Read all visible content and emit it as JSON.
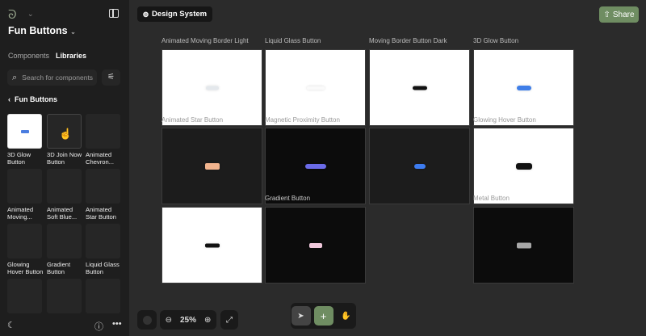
{
  "sidebar": {
    "project": "Fun Buttons",
    "tabs": [
      "Components",
      "Libraries"
    ],
    "search_placeholder": "Search for components",
    "breadcrumb": "Fun Buttons",
    "items": [
      "3D Glow Button",
      "3D Join Now Button",
      "Animated Chevron...",
      "Animated Moving...",
      "Animated Soft Blue...",
      "Animated Star Button",
      "Glowing Hover Button",
      "Gradient Button",
      "Liquid Glass Button",
      "",
      "",
      ""
    ]
  },
  "header": {
    "pill": "Design System",
    "share": "Share"
  },
  "canvas": {
    "labels": [
      "Animated Moving Border Light",
      "Liquid Glass Button",
      "Moving Border Button Dark",
      "3D Glow Button",
      "Animated Star Button",
      "Magnetic Proximity Button",
      "Glowing Hover Button",
      "Gradient Button",
      "Metal Button"
    ]
  },
  "toolbar": {
    "zoom": "25%"
  },
  "colors": {
    "accent": "#6f8d62"
  }
}
